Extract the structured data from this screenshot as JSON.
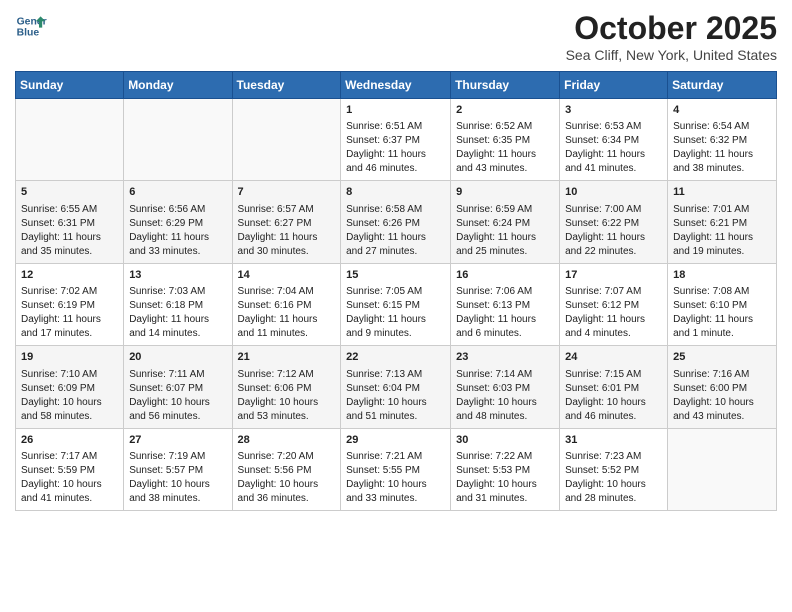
{
  "header": {
    "logo_line1": "General",
    "logo_line2": "Blue",
    "month": "October 2025",
    "location": "Sea Cliff, New York, United States"
  },
  "days_of_week": [
    "Sunday",
    "Monday",
    "Tuesday",
    "Wednesday",
    "Thursday",
    "Friday",
    "Saturday"
  ],
  "weeks": [
    [
      {
        "day": "",
        "content": ""
      },
      {
        "day": "",
        "content": ""
      },
      {
        "day": "",
        "content": ""
      },
      {
        "day": "1",
        "content": "Sunrise: 6:51 AM\nSunset: 6:37 PM\nDaylight: 11 hours and 46 minutes."
      },
      {
        "day": "2",
        "content": "Sunrise: 6:52 AM\nSunset: 6:35 PM\nDaylight: 11 hours and 43 minutes."
      },
      {
        "day": "3",
        "content": "Sunrise: 6:53 AM\nSunset: 6:34 PM\nDaylight: 11 hours and 41 minutes."
      },
      {
        "day": "4",
        "content": "Sunrise: 6:54 AM\nSunset: 6:32 PM\nDaylight: 11 hours and 38 minutes."
      }
    ],
    [
      {
        "day": "5",
        "content": "Sunrise: 6:55 AM\nSunset: 6:31 PM\nDaylight: 11 hours and 35 minutes."
      },
      {
        "day": "6",
        "content": "Sunrise: 6:56 AM\nSunset: 6:29 PM\nDaylight: 11 hours and 33 minutes."
      },
      {
        "day": "7",
        "content": "Sunrise: 6:57 AM\nSunset: 6:27 PM\nDaylight: 11 hours and 30 minutes."
      },
      {
        "day": "8",
        "content": "Sunrise: 6:58 AM\nSunset: 6:26 PM\nDaylight: 11 hours and 27 minutes."
      },
      {
        "day": "9",
        "content": "Sunrise: 6:59 AM\nSunset: 6:24 PM\nDaylight: 11 hours and 25 minutes."
      },
      {
        "day": "10",
        "content": "Sunrise: 7:00 AM\nSunset: 6:22 PM\nDaylight: 11 hours and 22 minutes."
      },
      {
        "day": "11",
        "content": "Sunrise: 7:01 AM\nSunset: 6:21 PM\nDaylight: 11 hours and 19 minutes."
      }
    ],
    [
      {
        "day": "12",
        "content": "Sunrise: 7:02 AM\nSunset: 6:19 PM\nDaylight: 11 hours and 17 minutes."
      },
      {
        "day": "13",
        "content": "Sunrise: 7:03 AM\nSunset: 6:18 PM\nDaylight: 11 hours and 14 minutes."
      },
      {
        "day": "14",
        "content": "Sunrise: 7:04 AM\nSunset: 6:16 PM\nDaylight: 11 hours and 11 minutes."
      },
      {
        "day": "15",
        "content": "Sunrise: 7:05 AM\nSunset: 6:15 PM\nDaylight: 11 hours and 9 minutes."
      },
      {
        "day": "16",
        "content": "Sunrise: 7:06 AM\nSunset: 6:13 PM\nDaylight: 11 hours and 6 minutes."
      },
      {
        "day": "17",
        "content": "Sunrise: 7:07 AM\nSunset: 6:12 PM\nDaylight: 11 hours and 4 minutes."
      },
      {
        "day": "18",
        "content": "Sunrise: 7:08 AM\nSunset: 6:10 PM\nDaylight: 11 hours and 1 minute."
      }
    ],
    [
      {
        "day": "19",
        "content": "Sunrise: 7:10 AM\nSunset: 6:09 PM\nDaylight: 10 hours and 58 minutes."
      },
      {
        "day": "20",
        "content": "Sunrise: 7:11 AM\nSunset: 6:07 PM\nDaylight: 10 hours and 56 minutes."
      },
      {
        "day": "21",
        "content": "Sunrise: 7:12 AM\nSunset: 6:06 PM\nDaylight: 10 hours and 53 minutes."
      },
      {
        "day": "22",
        "content": "Sunrise: 7:13 AM\nSunset: 6:04 PM\nDaylight: 10 hours and 51 minutes."
      },
      {
        "day": "23",
        "content": "Sunrise: 7:14 AM\nSunset: 6:03 PM\nDaylight: 10 hours and 48 minutes."
      },
      {
        "day": "24",
        "content": "Sunrise: 7:15 AM\nSunset: 6:01 PM\nDaylight: 10 hours and 46 minutes."
      },
      {
        "day": "25",
        "content": "Sunrise: 7:16 AM\nSunset: 6:00 PM\nDaylight: 10 hours and 43 minutes."
      }
    ],
    [
      {
        "day": "26",
        "content": "Sunrise: 7:17 AM\nSunset: 5:59 PM\nDaylight: 10 hours and 41 minutes."
      },
      {
        "day": "27",
        "content": "Sunrise: 7:19 AM\nSunset: 5:57 PM\nDaylight: 10 hours and 38 minutes."
      },
      {
        "day": "28",
        "content": "Sunrise: 7:20 AM\nSunset: 5:56 PM\nDaylight: 10 hours and 36 minutes."
      },
      {
        "day": "29",
        "content": "Sunrise: 7:21 AM\nSunset: 5:55 PM\nDaylight: 10 hours and 33 minutes."
      },
      {
        "day": "30",
        "content": "Sunrise: 7:22 AM\nSunset: 5:53 PM\nDaylight: 10 hours and 31 minutes."
      },
      {
        "day": "31",
        "content": "Sunrise: 7:23 AM\nSunset: 5:52 PM\nDaylight: 10 hours and 28 minutes."
      },
      {
        "day": "",
        "content": ""
      }
    ]
  ]
}
